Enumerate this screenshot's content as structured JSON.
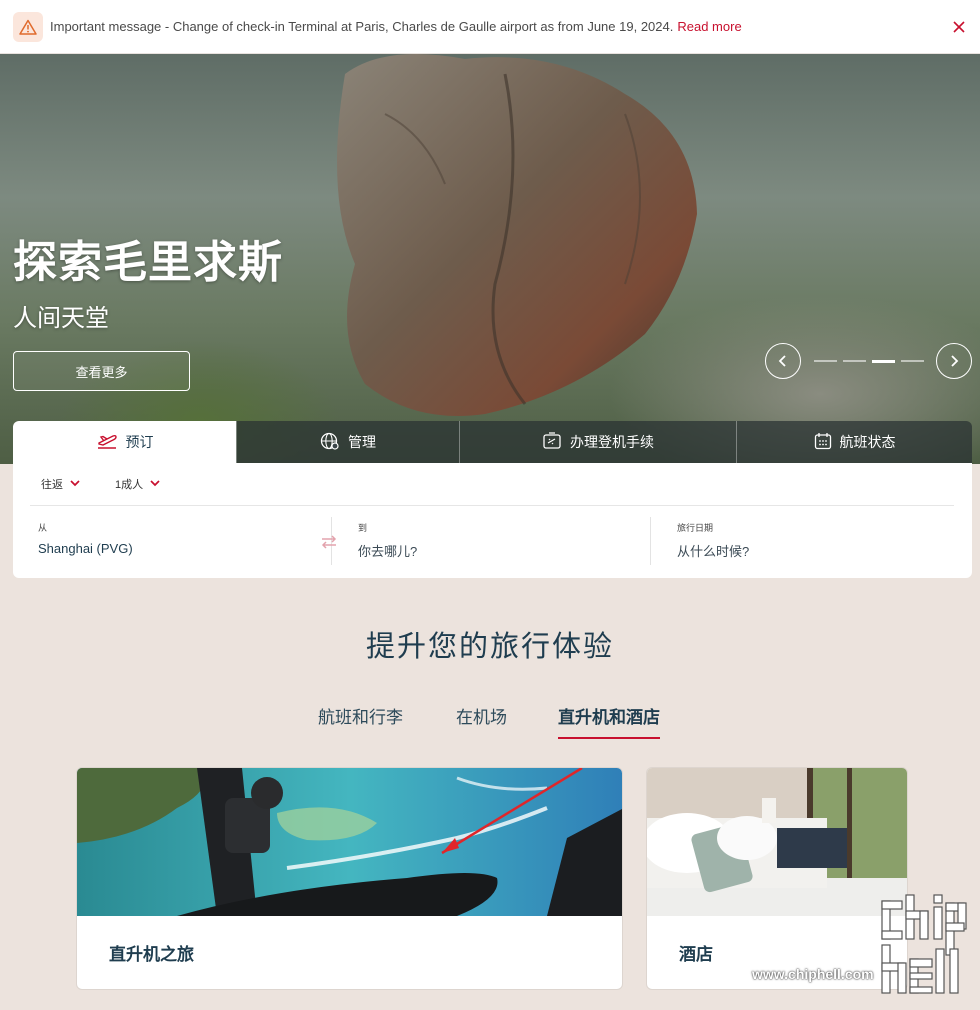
{
  "alert": {
    "message": "Important message - Change of check-in Terminal at Paris, Charles de Gaulle airport as from June 19, 2024.",
    "link": "Read more",
    "icon": "warning-icon"
  },
  "hero": {
    "title": "探索毛里求斯",
    "subtitle": "人间天堂",
    "cta": "查看更多",
    "slide_count": 4,
    "active_slide": 3
  },
  "booking": {
    "tabs": [
      {
        "label": "预订",
        "icon": "plane-takeoff-icon"
      },
      {
        "label": "管理",
        "icon": "globe-settings-icon"
      },
      {
        "label": "办理登机手续",
        "icon": "boarding-pass-icon"
      },
      {
        "label": "航班状态",
        "icon": "calendar-icon"
      }
    ],
    "trip_type": "往返",
    "passengers": "1成人",
    "from": {
      "label": "从",
      "value": "Shanghai (PVG)"
    },
    "to": {
      "label": "到",
      "placeholder": "你去哪儿?"
    },
    "date": {
      "label": "旅行日期",
      "placeholder": "从什么时候?"
    }
  },
  "enhance": {
    "title": "提升您的旅行体验",
    "tabs": [
      "航班和行李",
      "在机场",
      "直升机和酒店"
    ],
    "active_tab": 2,
    "cards": [
      {
        "title": "直升机之旅"
      },
      {
        "title": "酒店"
      }
    ]
  },
  "watermark": {
    "site": "www.chiphell.com",
    "logo": "chip hell"
  },
  "colors": {
    "accent": "#c8102e",
    "text": "#1f3d4f",
    "page_bg": "#ece3dd"
  }
}
